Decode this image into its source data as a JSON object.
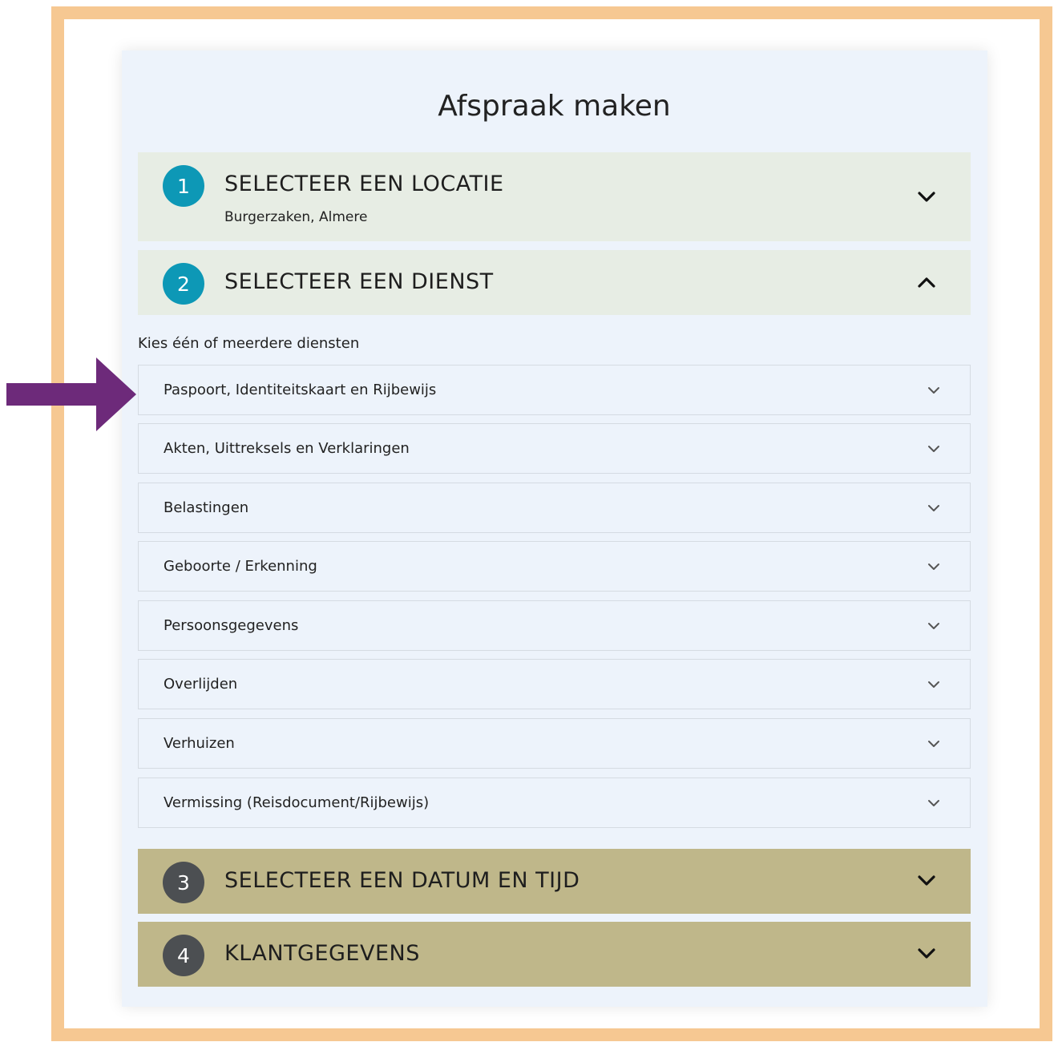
{
  "page": {
    "title": "Afspraak maken",
    "colors": {
      "frame": "#f6c892",
      "card_bg": "#edf3fb",
      "step_light_bg": "#e7ede4",
      "step_dark_bg": "#bfb78a",
      "teal": "#0d98b6",
      "grey": "#4c4f52",
      "arrow": "#6d2a7a"
    }
  },
  "steps": [
    {
      "number": "1",
      "title": "SELECTEER EEN LOCATIE",
      "subtitle": "Burgerzaken, Almere",
      "state": "collapsed",
      "icon": "chevron-down-icon"
    },
    {
      "number": "2",
      "title": "SELECTEER EEN DIENST",
      "state": "expanded",
      "icon": "chevron-up-icon"
    },
    {
      "number": "3",
      "title": "SELECTEER EEN DATUM EN TIJD",
      "state": "collapsed",
      "icon": "chevron-down-icon"
    },
    {
      "number": "4",
      "title": "KLANTGEGEVENS",
      "state": "collapsed",
      "icon": "chevron-down-icon"
    }
  ],
  "services": {
    "intro": "Kies één of meerdere diensten",
    "items": [
      {
        "label": "Paspoort, Identiteitskaart en Rijbewijs"
      },
      {
        "label": "Akten, Uittreksels en Verklaringen"
      },
      {
        "label": "Belastingen"
      },
      {
        "label": "Geboorte / Erkenning"
      },
      {
        "label": "Persoonsgegevens"
      },
      {
        "label": "Overlijden"
      },
      {
        "label": "Verhuizen"
      },
      {
        "label": "Vermissing (Reisdocument/Rijbewijs)"
      }
    ]
  },
  "annotation": {
    "icon": "arrow-right-icon"
  }
}
